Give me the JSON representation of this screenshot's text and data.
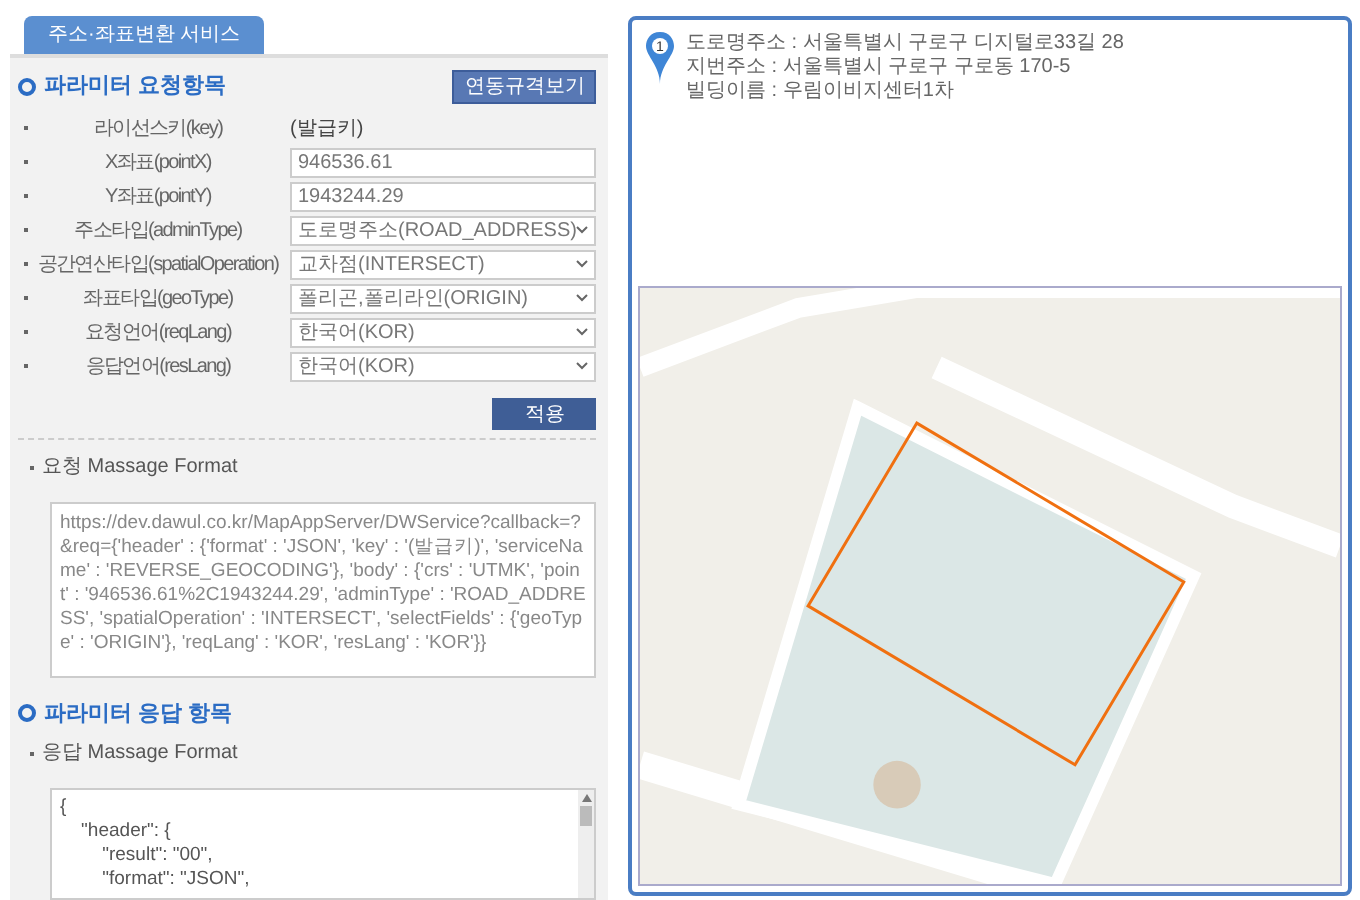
{
  "tab": {
    "label": "주소·좌표변환 서비스",
    "selected": true
  },
  "request_section": {
    "title": "파라미터 요청항목",
    "spec_button": "연동규격보기",
    "params": [
      {
        "kind": "text",
        "label": "라이선스키(key)",
        "value": "(발급키)"
      },
      {
        "kind": "input",
        "label": "X좌표(pointX)",
        "value": "946536.61"
      },
      {
        "kind": "input",
        "label": "Y좌표(pointY)",
        "value": "1943244.29"
      },
      {
        "kind": "select",
        "label": "주소타입(adminType)",
        "value": "도로명주소(ROAD_ADDRESS)"
      },
      {
        "kind": "select",
        "label": "공간연산타입(spatialOperation)",
        "value": "교차점(INTERSECT)"
      },
      {
        "kind": "select",
        "label": "좌표타입(geoType)",
        "value": "폴리곤,폴리라인(ORIGIN)"
      },
      {
        "kind": "select",
        "label": "요청언어(reqLang)",
        "value": "한국어(KOR)"
      },
      {
        "kind": "select",
        "label": "응답언어(resLang)",
        "value": "한국어(KOR)"
      }
    ],
    "apply_button": "적용",
    "format_label": "요청 Massage Format",
    "format_text": "https://dev.dawul.co.kr/MapAppServer/DWService?callback=?&req={'header' : {'format' : 'JSON', 'key' : '(발급키)', 'serviceName' : 'REVERSE_GEOCODING'}, 'body' : {'crs' : 'UTMK', 'point' : '946536.61%2C1943244.29', 'adminType' : 'ROAD_ADDRESS', 'spatialOperation' : 'INTERSECT', 'selectFields' : {'geoType' : 'ORIGIN'}, 'reqLang' : 'KOR', 'resLang' : 'KOR'}}"
  },
  "response_section": {
    "title": "파라미터 응답 항목",
    "format_label": "응답 Massage Format",
    "format_lines": [
      "{",
      "    \"header\": {",
      "        \"result\": \"00\",",
      "        \"format\": \"JSON\","
    ]
  },
  "result": {
    "marker": "1",
    "lines": [
      "도로명주소 : 서울특별시 구로구 디지털로33길 28",
      "지번주소 : 서울특별시 구로구 구로동 170-5",
      "빌딩이름 : 우림이비지센터1차"
    ]
  }
}
